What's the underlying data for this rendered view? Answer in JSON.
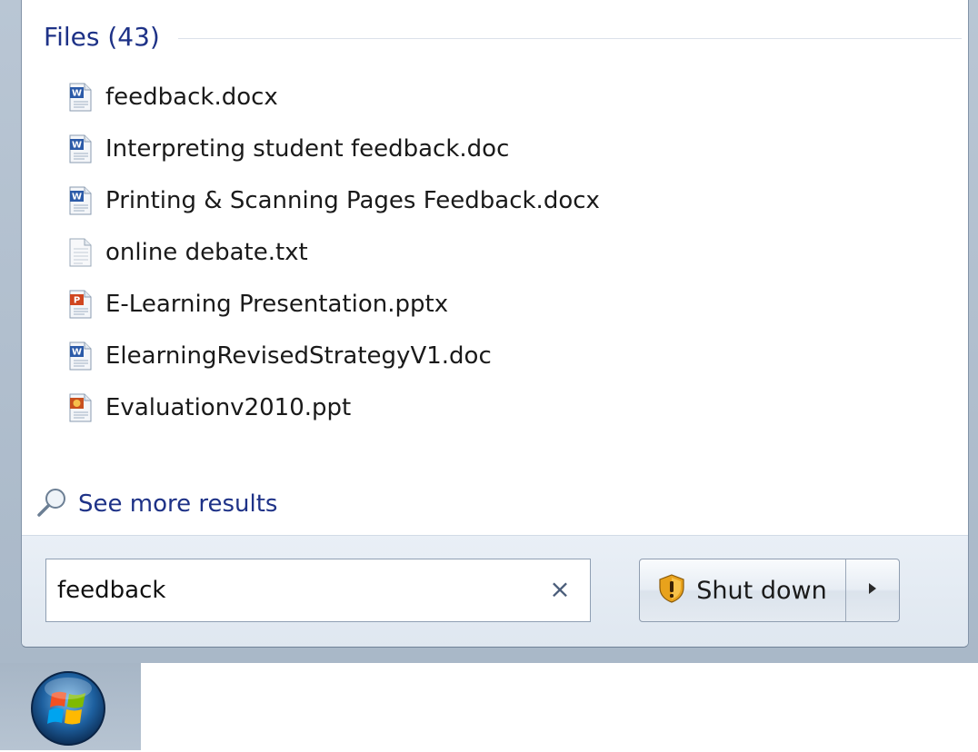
{
  "files_section": {
    "title": "Files (43)"
  },
  "files": [
    {
      "name": "feedback.docx",
      "icon": "word-doc-icon"
    },
    {
      "name": "Interpreting student feedback.doc",
      "icon": "word-doc-icon"
    },
    {
      "name": "Printing & Scanning Pages Feedback.docx",
      "icon": "word-doc-icon"
    },
    {
      "name": "online debate.txt",
      "icon": "text-file-icon"
    },
    {
      "name": "E-Learning Presentation.pptx",
      "icon": "powerpoint-icon"
    },
    {
      "name": "ElearningRevisedStrategyV1.doc",
      "icon": "word-doc-icon"
    },
    {
      "name": "Evaluationv2010.ppt",
      "icon": "powerpoint-icon"
    }
  ],
  "see_more": {
    "label": "See more results",
    "icon": "magnifier-icon"
  },
  "search": {
    "value": "feedback",
    "clear_icon": "close-icon",
    "clear_glyph": "×"
  },
  "shutdown": {
    "label": "Shut down",
    "icon": "uac-shield-icon",
    "arrow_icon": "triangle-right-icon"
  },
  "taskbar": {
    "start_icon": "windows-start-orb-icon"
  },
  "colors": {
    "link_blue": "#1e3287",
    "frame": "#b9c6d4"
  }
}
